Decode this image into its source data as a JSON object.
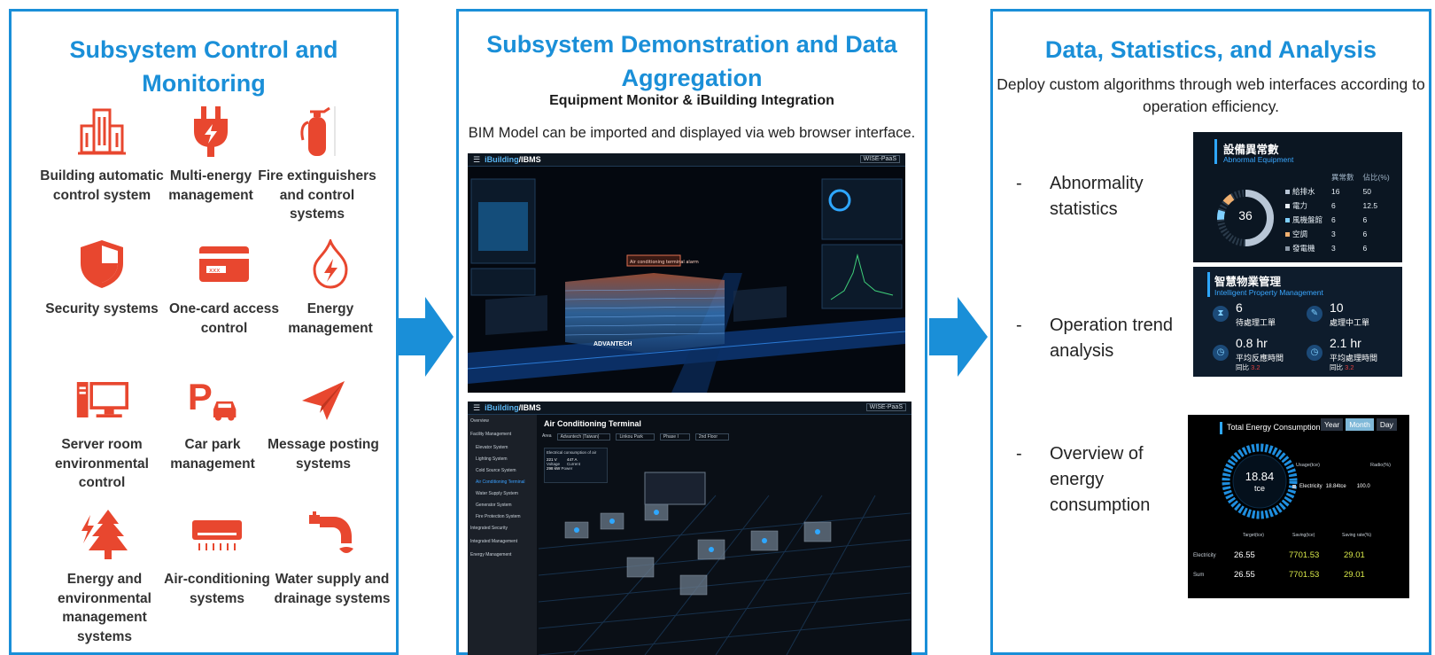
{
  "left_panel": {
    "title": "Subsystem Control and Monitoring",
    "items": [
      {
        "label": "Building automatic control system",
        "icon": "building-icon"
      },
      {
        "label": "Multi-energy management",
        "icon": "plug-icon"
      },
      {
        "label": "Fire extinguishers and control systems",
        "icon": "fire-extinguisher-icon"
      },
      {
        "label": "Security systems",
        "icon": "shield-icon"
      },
      {
        "label": "One-card access control",
        "icon": "access-card-icon"
      },
      {
        "label": "Energy management",
        "icon": "flame-bolt-icon"
      },
      {
        "label": "Server room environmental control",
        "icon": "computer-icon"
      },
      {
        "label": "Car park management",
        "icon": "parking-icon"
      },
      {
        "label": "Message posting systems",
        "icon": "paper-plane-icon"
      },
      {
        "label": "Energy and environmental management systems",
        "icon": "tree-bolt-icon"
      },
      {
        "label": "Air-conditioning systems",
        "icon": "air-conditioner-icon"
      },
      {
        "label": "Water supply and drainage systems",
        "icon": "faucet-icon"
      }
    ]
  },
  "middle_panel": {
    "title": "Subsystem Demonstration and Data Aggregation",
    "subtitle": "Equipment Monitor & iBuilding Integration",
    "description": "BIM Model can be imported and displayed via web browser interface.",
    "screenshot1": {
      "brand": "iBuilding",
      "brand2": "/IBMS",
      "badge": "WISE-PaaS",
      "label": "ADVANTECH",
      "alarm": "Air conditioning terminal alarm"
    },
    "screenshot2": {
      "brand": "iBuilding",
      "brand2": "/IBMS",
      "badge": "WISE-PaaS",
      "page_title": "Air Conditioning Terminal",
      "nav": [
        "Overview",
        "Facility Management",
        "Elevator System",
        "Lighting System",
        "Cold Source System",
        "Air Conditioning Terminal",
        "Water Supply System",
        "Generator System",
        "Fire Protection System",
        "Integrated Security",
        "Integrated Management",
        "Energy Management"
      ],
      "filters": [
        "Area",
        "Advantech (Taiwan)",
        "Linkou Park",
        "Phase I",
        "2nd Floor"
      ],
      "consumption_title": "Electrical consumption of air",
      "metrics": [
        {
          "value": "221 V",
          "label": "Voltage"
        },
        {
          "value": "447 A",
          "label": "Current"
        },
        {
          "value": "298 kW",
          "label": "Power"
        }
      ]
    }
  },
  "right_panel": {
    "title": "Data, Statistics, and Analysis",
    "description": "Deploy custom algorithms through web interfaces according to operation efficiency.",
    "bullets": [
      {
        "dash": "-",
        "text": "Abnormality statistics"
      },
      {
        "dash": "-",
        "text": "Operation trend analysis"
      },
      {
        "dash": "-",
        "text": "Overview of energy consumption"
      }
    ],
    "abnormal_card": {
      "title": "設備異常數",
      "subtitle": "Abnormal Equipment",
      "total": "36",
      "headers": [
        "異常數",
        "佔比(%)"
      ],
      "rows": [
        {
          "name": "給排水",
          "count": "16",
          "pct": "50",
          "color": "#b8c6d6"
        },
        {
          "name": "電力",
          "count": "6",
          "pct": "12.5",
          "color": "#e8eef4"
        },
        {
          "name": "風機盤館",
          "count": "6",
          "pct": "6",
          "color": "#7fd0ff"
        },
        {
          "name": "空調",
          "count": "3",
          "pct": "6",
          "color": "#f0b070"
        },
        {
          "name": "發電機",
          "count": "3",
          "pct": "6",
          "color": "#8a97a6"
        }
      ]
    },
    "property_card": {
      "title": "智慧物業管理",
      "subtitle": "Intelligent Property Management",
      "stats": [
        {
          "value": "6",
          "label": "待處理工單",
          "icon": "hourglass-icon"
        },
        {
          "value": "10",
          "label": "處理中工單",
          "icon": "wrench-icon"
        },
        {
          "value": "0.8 hr",
          "label": "平均反應時間",
          "note_label": "同比",
          "note_value": "3.2",
          "icon": "clock-icon"
        },
        {
          "value": "2.1 hr",
          "label": "平均處理時間",
          "note_label": "同比",
          "note_value": "3.2",
          "icon": "clock-icon"
        }
      ]
    },
    "energy_card": {
      "title": "Total Energy Consumption",
      "tabs": [
        "Year",
        "Month",
        "Day"
      ],
      "active_tab": "Month",
      "gauge_value": "18.84",
      "gauge_unit": "tce",
      "usage_header": "Usage(tce)",
      "ratio_header": "Radio(%)",
      "legend_item": "Electricity",
      "legend_value": "18.84tce",
      "legend_ratio": "100.0",
      "table_headers": [
        "Target(tce)",
        "Saving(tce)",
        "Saving rate(%)"
      ],
      "rows": [
        {
          "name": "Electricity",
          "target": "26.55",
          "saving": "7701.53",
          "rate": "29.01"
        },
        {
          "name": "Sum",
          "target": "26.55",
          "saving": "7701.53",
          "rate": "29.01"
        }
      ]
    }
  },
  "colors": {
    "accent_blue": "#1a8fd8",
    "icon_red": "#e8472f",
    "dark_bg": "#0b1622"
  }
}
